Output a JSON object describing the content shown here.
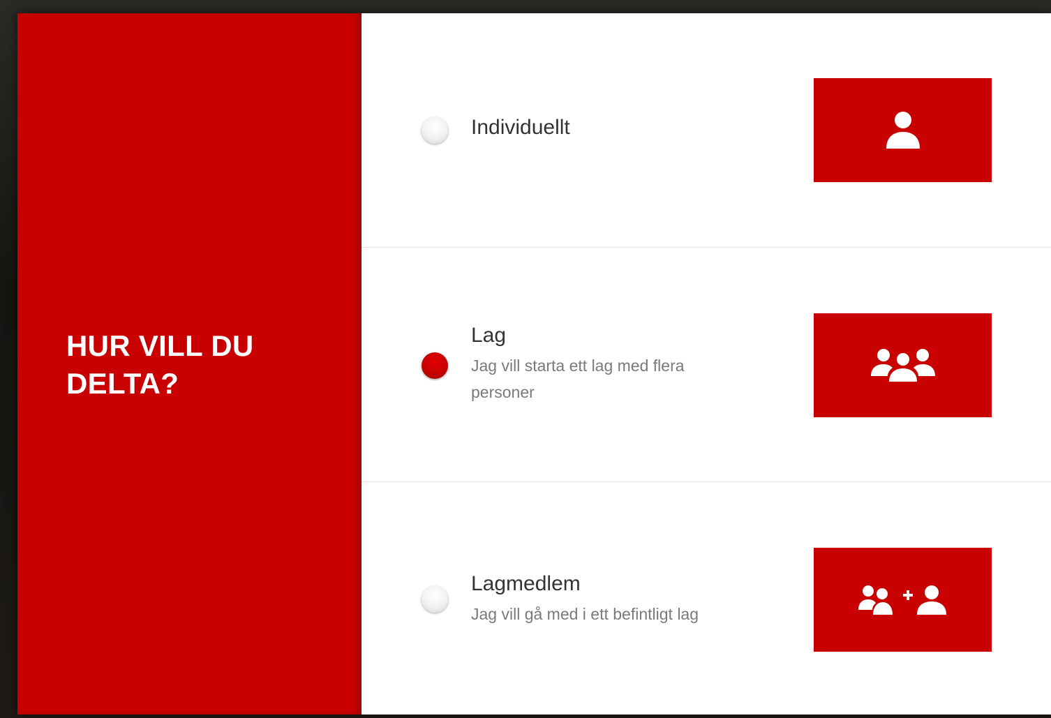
{
  "heading": "HUR VILL DU DELTA?",
  "options": [
    {
      "title": "Individuellt",
      "description": "",
      "selected": false,
      "icon": "user-icon"
    },
    {
      "title": "Lag",
      "description": "Jag vill starta ett lag med flera personer",
      "selected": true,
      "icon": "users-group-icon"
    },
    {
      "title": "Lagmedlem",
      "description": "Jag vill gå med i ett befintligt lag",
      "selected": false,
      "icon": "join-group-icon"
    }
  ],
  "colors": {
    "brand_red": "#c80000",
    "text_dark": "#333333",
    "text_muted": "#7a7a7a"
  }
}
